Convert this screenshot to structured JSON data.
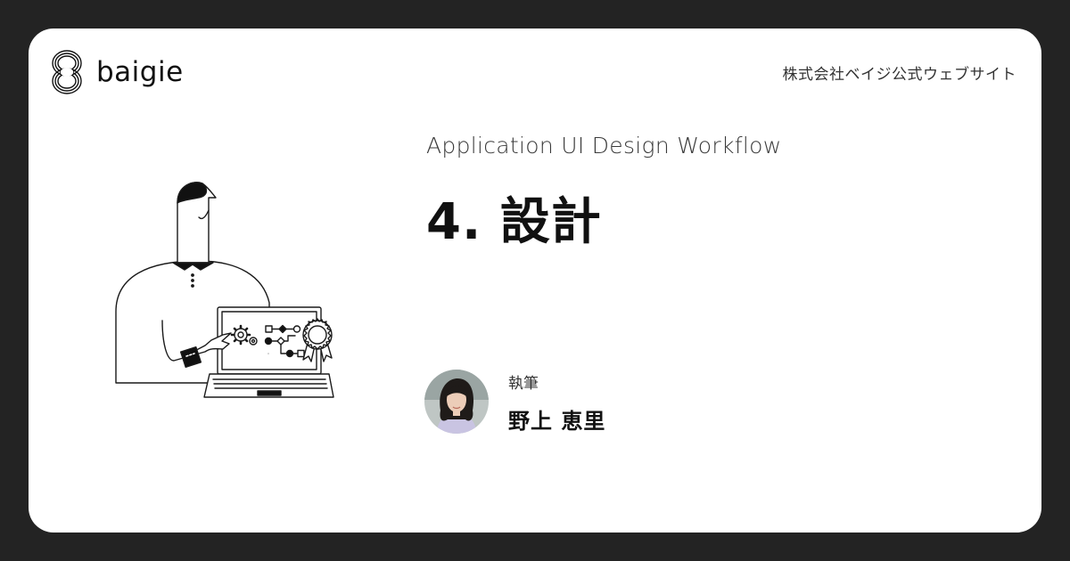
{
  "brand": {
    "name": "baigie"
  },
  "header": {
    "site_link": "株式会社ベイジ公式ウェブサイト"
  },
  "article": {
    "series": "Application UI Design Workflow",
    "title": "4. 設計"
  },
  "author": {
    "role": "執筆",
    "name": "野上 恵里"
  },
  "colors": {
    "background": "#232323",
    "card": "#ffffff",
    "text": "#111111"
  },
  "icons": [
    "baigie-logo-icon",
    "designer-laptop-illustration",
    "author-avatar"
  ]
}
